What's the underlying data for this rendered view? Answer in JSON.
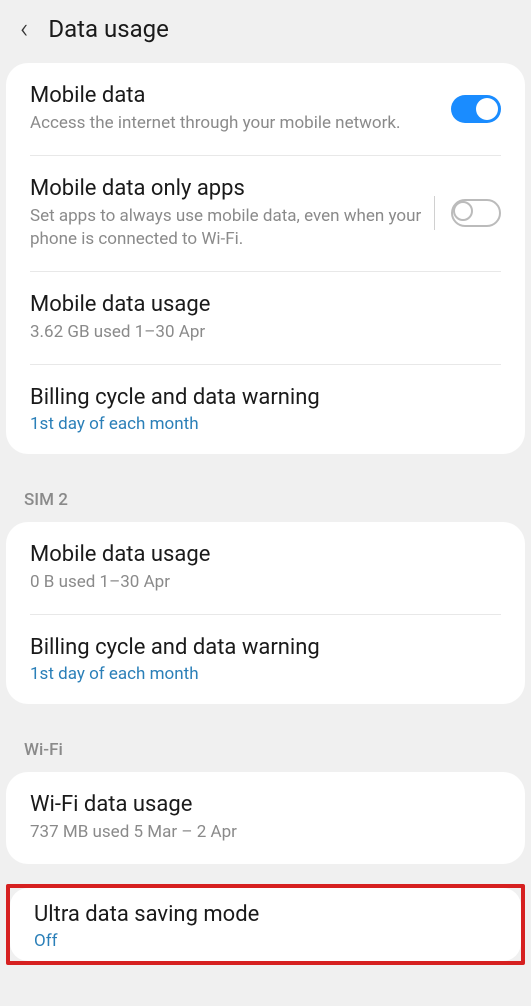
{
  "header": {
    "title": "Data usage"
  },
  "mobileData": {
    "title": "Mobile data",
    "sub": "Access the internet through your mobile network.",
    "toggle": "on"
  },
  "mobileDataOnlyApps": {
    "title": "Mobile data only apps",
    "sub": "Set apps to always use mobile data, even when your phone is connected to Wi-Fi.",
    "toggle": "off"
  },
  "mobileDataUsage1": {
    "title": "Mobile data usage",
    "sub": "3.62 GB used 1–30 Apr"
  },
  "billing1": {
    "title": "Billing cycle and data warning",
    "sub": "1st day of each month"
  },
  "sim2": {
    "label": "SIM 2"
  },
  "mobileDataUsage2": {
    "title": "Mobile data usage",
    "sub": "0 B used 1–30 Apr"
  },
  "billing2": {
    "title": "Billing cycle and data warning",
    "sub": "1st day of each month"
  },
  "wifi": {
    "label": "Wi-Fi"
  },
  "wifiUsage": {
    "title": "Wi-Fi data usage",
    "sub": "737 MB used 5 Mar – 2 Apr"
  },
  "ultra": {
    "title": "Ultra data saving mode",
    "sub": "Off"
  }
}
